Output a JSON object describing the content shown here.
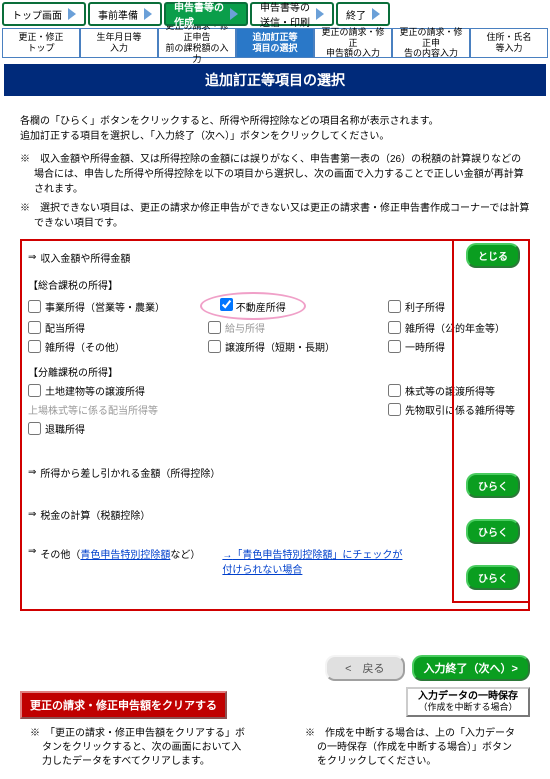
{
  "topnav": [
    {
      "label": "トップ画面"
    },
    {
      "label": "事前準備"
    },
    {
      "label": "申告書等の\n作成",
      "active": true
    },
    {
      "label": "申告書等の\n送信・印刷"
    },
    {
      "label": "終了"
    }
  ],
  "subnav": [
    {
      "label": "更正・修正\nトップ"
    },
    {
      "label": "生年月日等\n入力"
    },
    {
      "label": "更正の請求・修正申告\n前の課税額の入力"
    },
    {
      "label": "追加訂正等\n項目の選択",
      "active": true
    },
    {
      "label": "更正の請求・修正\n申告額の入力"
    },
    {
      "label": "更正の請求・修正申\n告の内容入力"
    },
    {
      "label": "住所・氏名\n等入力"
    }
  ],
  "title": "追加訂正等項目の選択",
  "intro1": "各欄の「ひらく」ボタンをクリックすると、所得や所得控除などの項目名称が表示されます。",
  "intro2": "追加訂正する項目を選択し、「入力終了（次へ）」ボタンをクリックしてください。",
  "note1": "※　収入金額や所得金額、又は所得控除の金額には誤りがなく、申告書第一表の（26）の税額の計算誤りなどの場合には、申告した所得や所得控除を以下の項目から選択し、次の画面で入力することで正しい金額が再計算されます。",
  "note2": "※　選択できない項目は、更正の請求か修正申告ができない又は更正の請求書・修正申告書作成コーナーでは計算できない項目です。",
  "sections": {
    "income": {
      "arrow": "⇒",
      "label": "収入金額や所得金額",
      "btn": "とじる"
    },
    "deduct": {
      "arrow": "⇒",
      "label": "所得から差し引かれる金額（所得控除）",
      "btn": "ひらく"
    },
    "tax": {
      "arrow": "⇒",
      "label": "税金の計算（税額控除）",
      "btn": "ひらく"
    },
    "other": {
      "arrow": "⇒",
      "label_pre": "その他（",
      "link": "青色申告特別控除額",
      "label_post": "など）",
      "faq_pre": "→",
      "faq": "「青色申告特別控除額」にチェックが付けられない場合",
      "btn": "ひらく"
    }
  },
  "group1": {
    "title": "【総合課税の所得】",
    "items": [
      {
        "label": "事業所得（営業等・農業）"
      },
      {
        "label": "不動産所得",
        "checked": true,
        "hl": true
      },
      {
        "label": "利子所得"
      },
      {
        "label": "配当所得"
      },
      {
        "label": "給与所得",
        "gray": true
      },
      {
        "label": "雑所得（公的年金等）"
      },
      {
        "label": "雑所得（その他）"
      },
      {
        "label": "譲渡所得（短期・長期）"
      },
      {
        "label": "一時所得"
      }
    ]
  },
  "group2": {
    "title": "【分離課税の所得】",
    "items": [
      {
        "label": "土地建物等の譲渡所得"
      },
      {
        "label": ""
      },
      {
        "label": "株式等の譲渡所得等"
      },
      {
        "label": "上場株式等に係る配当所得等",
        "gray": true,
        "nochk": true
      },
      {
        "label": ""
      },
      {
        "label": "先物取引に係る雑所得等"
      },
      {
        "label": "退職所得"
      }
    ]
  },
  "footer": {
    "back": "<　戻る",
    "next": "入力終了（次へ）>"
  },
  "clear": "更正の請求・修正申告額をクリアする",
  "save": {
    "l1": "入力データの一時保存",
    "l2": "（作成を中断する場合）"
  },
  "bnote1": "※　「更正の請求・修正申告額をクリアする」ボタンをクリックすると、次の画面において入力したデータをすべてクリアします。",
  "bnote2": "※　作成を中断する場合は、上の「入力データの一時保存（作成を中断する場合）」ボタンをクリックしてください。"
}
